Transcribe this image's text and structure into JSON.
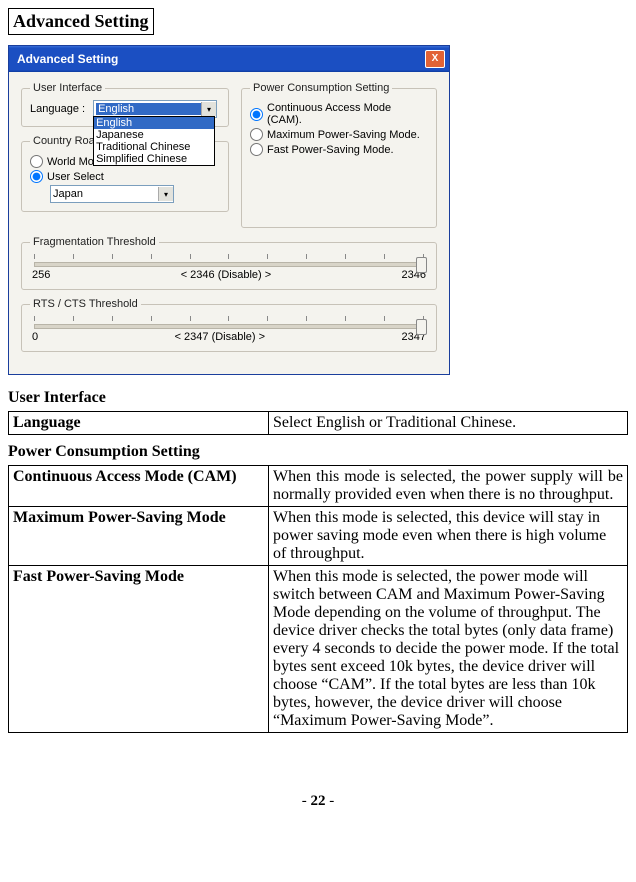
{
  "page": {
    "title": "Advanced Setting",
    "number": "22"
  },
  "dialog": {
    "title": "Advanced Setting",
    "close_glyph": "X",
    "ui_group": {
      "legend": "User Interface",
      "lang_label": "Language :",
      "combo_selected": "English",
      "options": [
        "English",
        "Japanese",
        "Traditional Chinese",
        "Simplified Chinese"
      ]
    },
    "country_group": {
      "legend": "Country Roaming",
      "world_mode": "World Mode",
      "user_select": "User Select",
      "country_combo": "Japan"
    },
    "pcs_group": {
      "legend": "Power Consumption Setting",
      "opt1": "Continuous Access Mode (CAM).",
      "opt2": "Maximum Power-Saving Mode.",
      "opt3": "Fast Power-Saving Mode."
    },
    "frag_group": {
      "legend": "Fragmentation Threshold",
      "min": "256",
      "center": "< 2346 (Disable) >",
      "max": "2346"
    },
    "rts_group": {
      "legend": "RTS / CTS Threshold",
      "min": "0",
      "center": "< 2347 (Disable) >",
      "max": "2347"
    }
  },
  "sections": {
    "ui_header": "User Interface",
    "pcs_header": "Power Consumption Setting"
  },
  "table1": {
    "r1c1": "Language",
    "r1c2": "Select English or Traditional Chinese."
  },
  "table2": {
    "r1c1": "Continuous Access Mode (CAM)",
    "r1c2": "When this mode is selected, the power supply will be normally provided even when there is no throughput.",
    "r2c1": "Maximum Power-Saving Mode",
    "r2c2": "When this mode is selected, this device will stay in power saving mode even when there is high volume of throughput.",
    "r3c1": "Fast Power-Saving Mode",
    "r3c2": "When this mode is selected, the power mode will switch between CAM and Maximum Power-Saving Mode depending on the volume of throughput. The device driver checks the total bytes (only data frame) every 4 seconds to decide the power mode. If the total bytes sent exceed 10k bytes, the device driver will choose “CAM”. If the total bytes are less than 10k bytes, however, the device driver will choose “Maximum Power-Saving Mode”."
  }
}
